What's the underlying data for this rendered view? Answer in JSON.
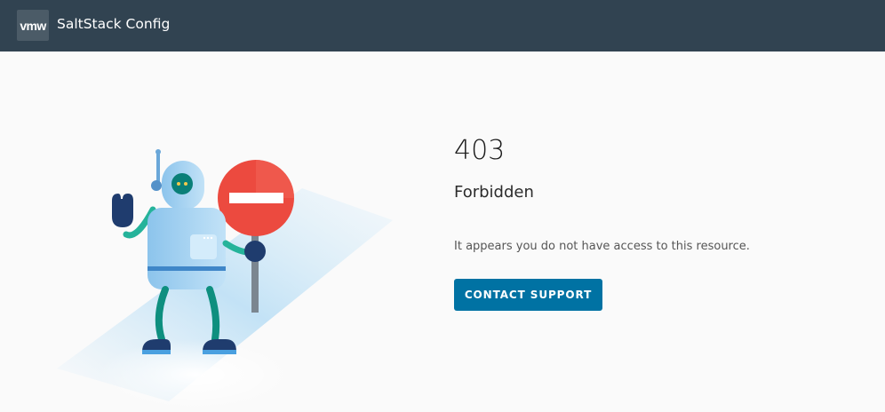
{
  "header": {
    "logo_text": "vmw",
    "app_title": "SaltStack Config"
  },
  "error": {
    "code": "403",
    "title": "Forbidden",
    "message": "It appears you do not have access to this resource."
  },
  "actions": {
    "contact_support_label": "CONTACT SUPPORT"
  },
  "colors": {
    "header_bg": "#314351",
    "button_bg": "#0072a3",
    "stop_sign": "#e8453c",
    "robot_body": "#a8d3f2"
  },
  "illustration": {
    "subject": "robot holding a stop sign"
  }
}
